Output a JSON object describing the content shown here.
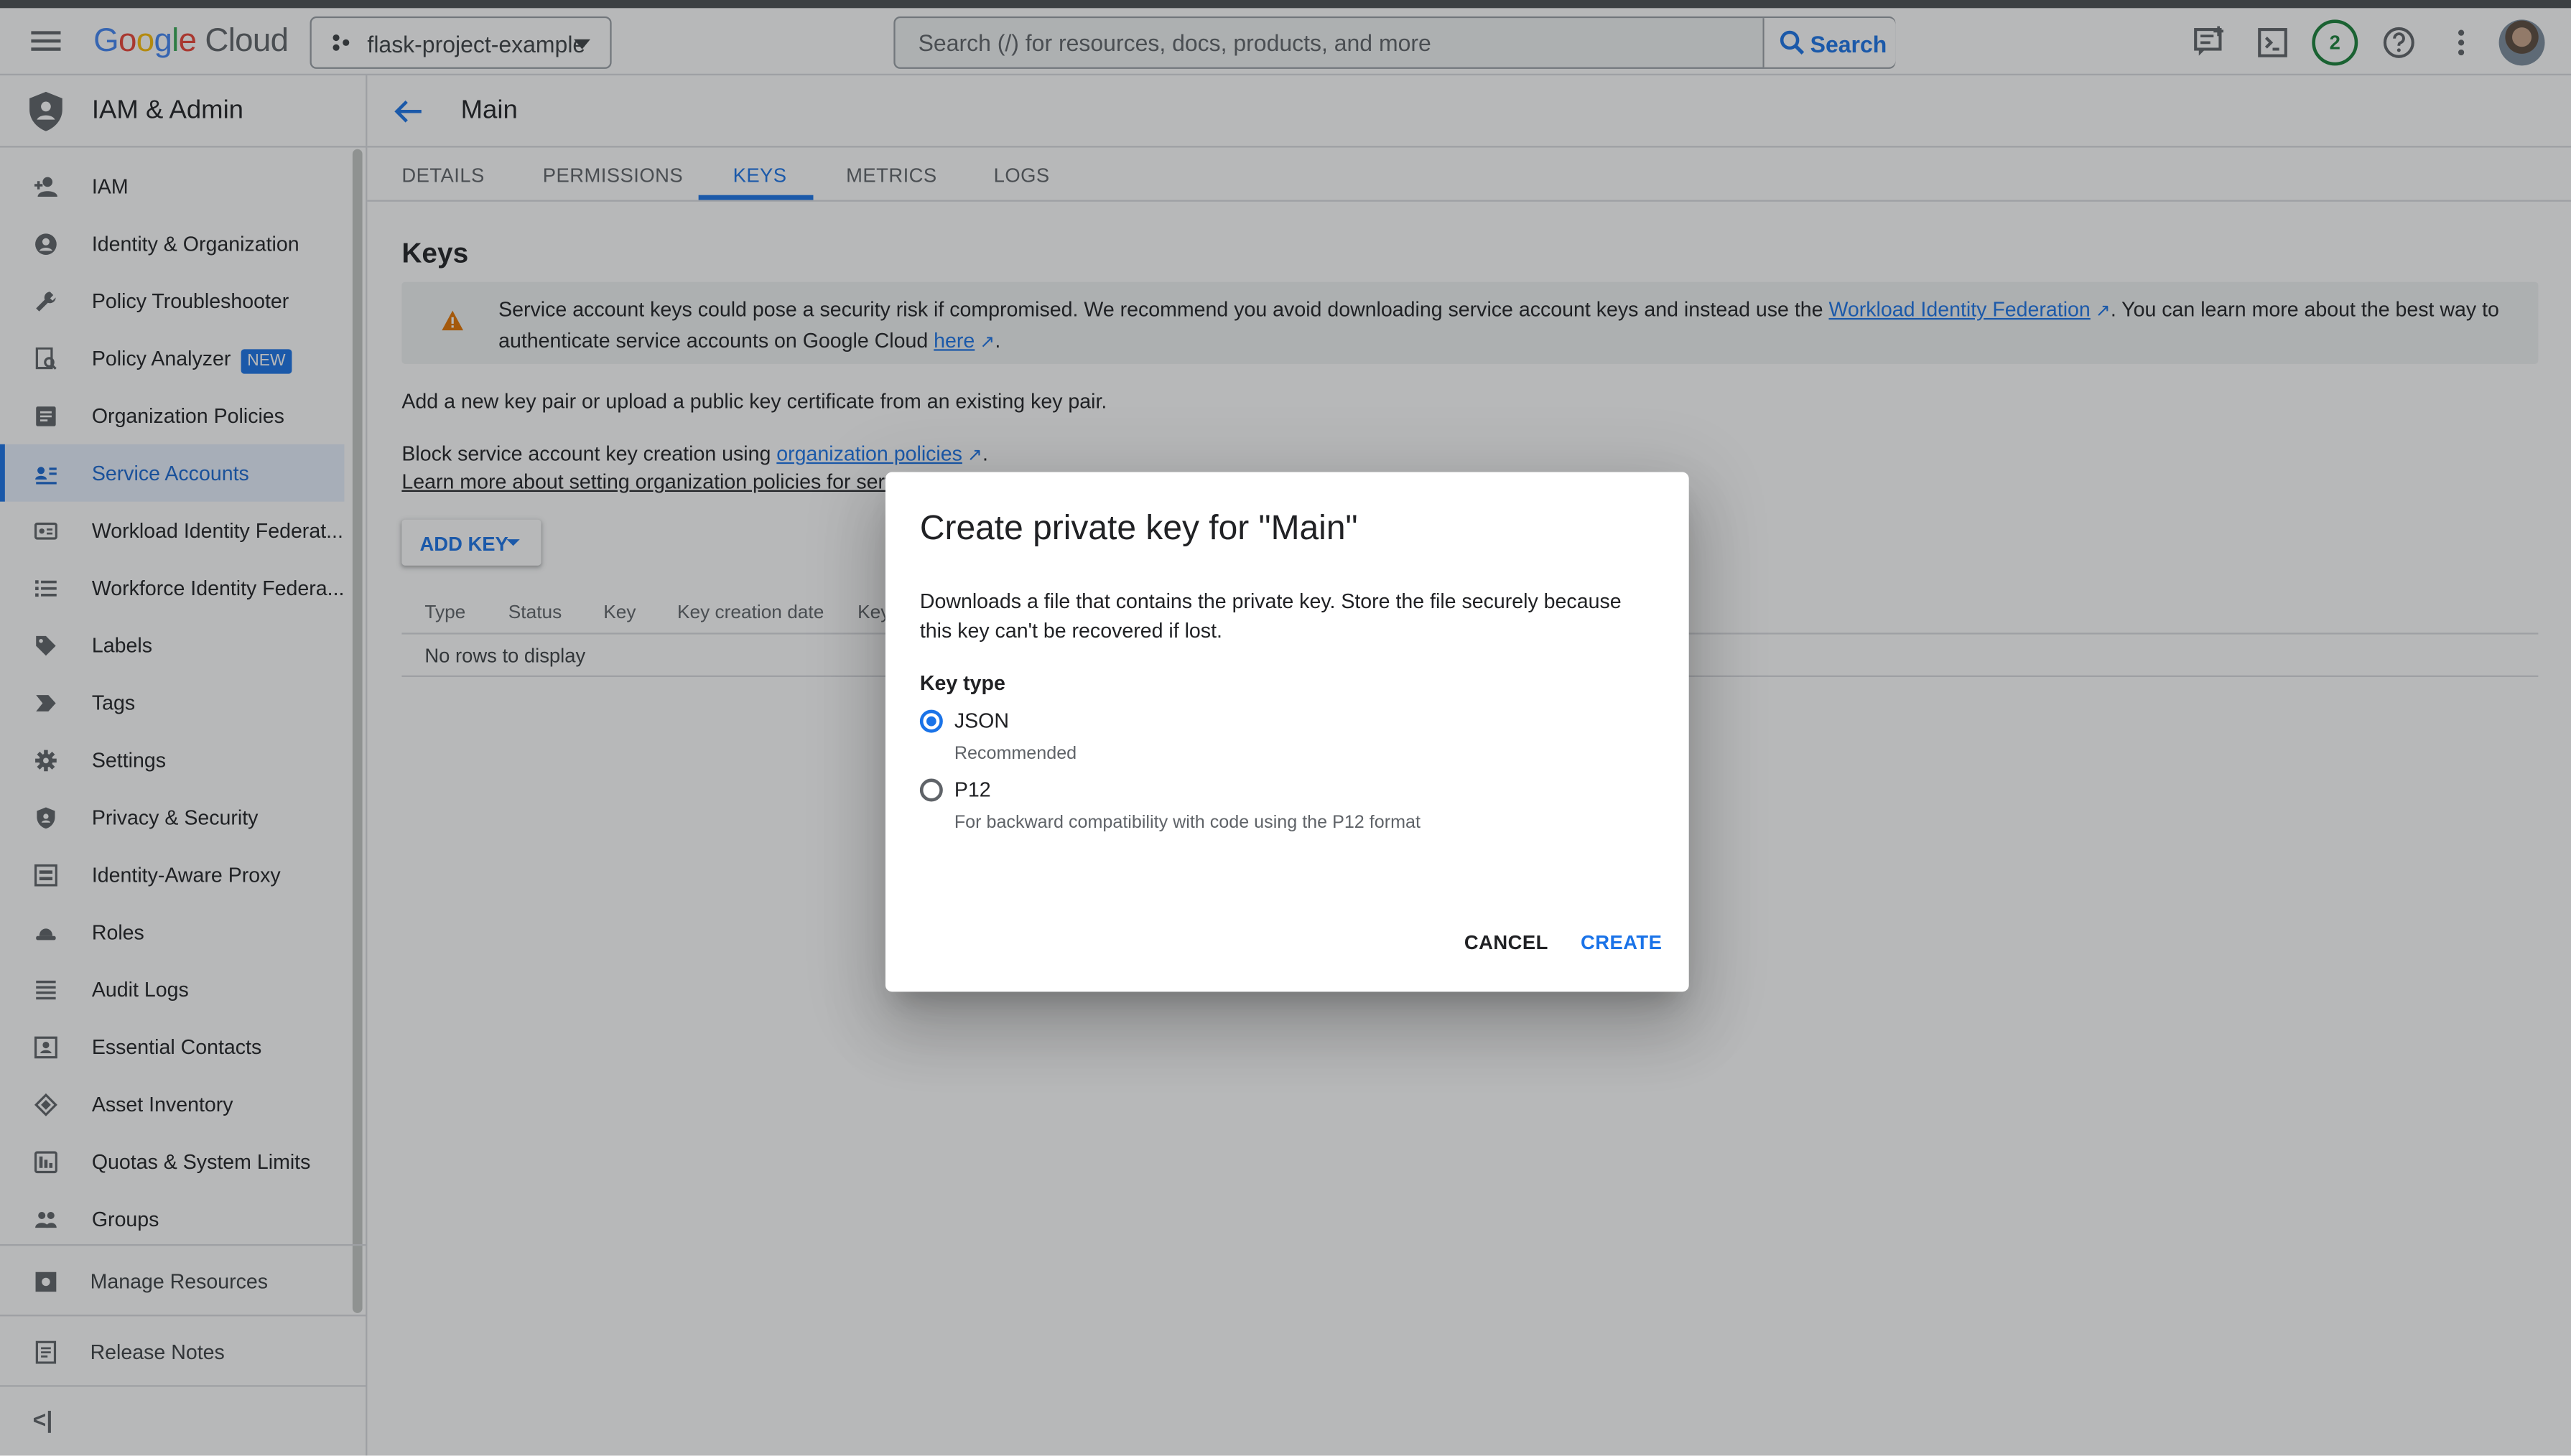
{
  "header": {
    "logo_google": "Google",
    "logo_cloud": "Cloud",
    "project_name": "flask-project-example",
    "search_placeholder": "Search (/) for resources, docs, products, and more",
    "search_button": "Search",
    "notification_count": "2"
  },
  "sidebar": {
    "title": "IAM & Admin",
    "items": [
      {
        "label": "IAM",
        "icon": "person-add-icon"
      },
      {
        "label": "Identity & Organization",
        "icon": "account-circle-icon"
      },
      {
        "label": "Policy Troubleshooter",
        "icon": "wrench-icon"
      },
      {
        "label": "Policy Analyzer",
        "icon": "policy-analyzer-icon",
        "badge": "NEW"
      },
      {
        "label": "Organization Policies",
        "icon": "list-doc-icon"
      },
      {
        "label": "Service Accounts",
        "icon": "service-account-icon",
        "active": true
      },
      {
        "label": "Workload Identity Federat...",
        "icon": "id-card-icon"
      },
      {
        "label": "Workforce Identity Federa...",
        "icon": "list-icon"
      },
      {
        "label": "Labels",
        "icon": "label-icon"
      },
      {
        "label": "Tags",
        "icon": "tag-icon"
      },
      {
        "label": "Settings",
        "icon": "gear-icon"
      },
      {
        "label": "Privacy & Security",
        "icon": "shield-icon"
      },
      {
        "label": "Identity-Aware Proxy",
        "icon": "proxy-icon"
      },
      {
        "label": "Roles",
        "icon": "hat-icon"
      },
      {
        "label": "Audit Logs",
        "icon": "lines-icon"
      },
      {
        "label": "Essential Contacts",
        "icon": "contact-icon"
      },
      {
        "label": "Asset Inventory",
        "icon": "layers-icon"
      },
      {
        "label": "Quotas & System Limits",
        "icon": "quota-icon"
      },
      {
        "label": "Groups",
        "icon": "group-icon"
      }
    ],
    "manage_resources": "Manage Resources",
    "release_notes": "Release Notes",
    "collapse": "<|"
  },
  "main": {
    "title": "Main",
    "tabs": [
      "DETAILS",
      "PERMISSIONS",
      "KEYS",
      "METRICS",
      "LOGS"
    ],
    "active_tab": "KEYS",
    "section_title": "Keys",
    "warning": {
      "text_1": "Service account keys could pose a security risk if compromised. We recommend you avoid downloading service account keys and instead use the ",
      "link_1": "Workload Identity Federation",
      "text_2": ". You can learn more about the best way to authenticate service accounts on Google Cloud ",
      "link_2": "here",
      "text_3": "."
    },
    "add_key_text": "Add a new key pair or upload a public key certificate from an existing key pair.",
    "block_text": "Block service account key creation using ",
    "block_link": "organization policies",
    "block_end": ".",
    "learn_more": "Learn more about setting organization policies for service",
    "add_key_button": "ADD KEY",
    "table": {
      "columns": [
        "Type",
        "Status",
        "Key",
        "Key creation date",
        "Key"
      ],
      "empty": "No rows to display"
    }
  },
  "dialog": {
    "title": "Create private key for \"Main\"",
    "description": "Downloads a file that contains the private key. Store the file securely because this key can't be recovered if lost.",
    "key_type_label": "Key type",
    "options": [
      {
        "label": "JSON",
        "sub": "Recommended",
        "selected": true
      },
      {
        "label": "P12",
        "sub": "For backward compatibility with code using the P12 format",
        "selected": false
      }
    ],
    "cancel": "CANCEL",
    "create": "CREATE"
  },
  "colors": {
    "accent": "#1a73e8",
    "warning": "#e37400",
    "badge_green": "#188038"
  }
}
